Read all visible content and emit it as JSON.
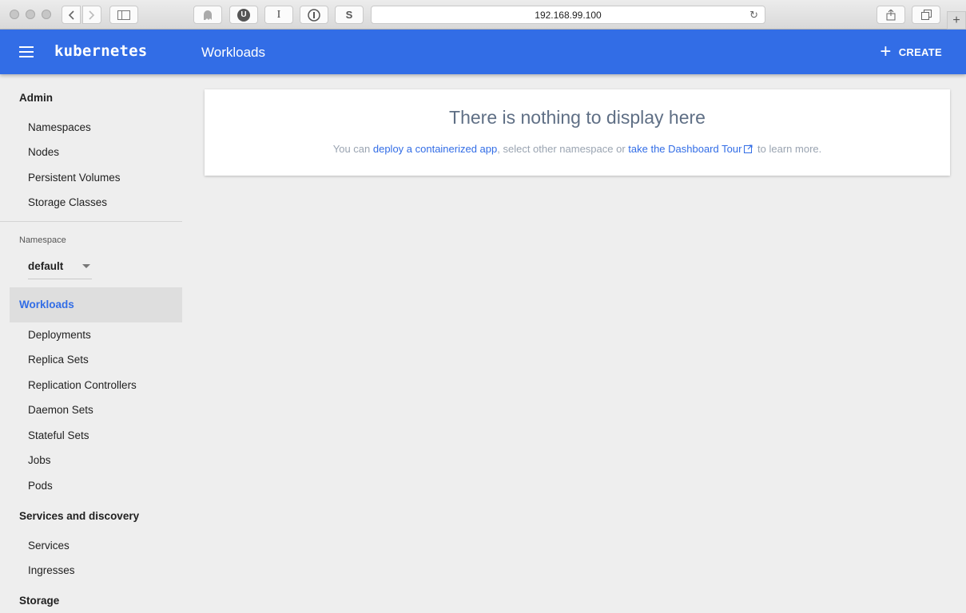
{
  "browser": {
    "url": "192.168.99.100",
    "toolbar_buttons": [
      "back-icon",
      "forward-icon",
      "sidebar-icon"
    ],
    "extension_labels": [
      "U",
      "I",
      "S"
    ]
  },
  "appbar": {
    "brand": "kubernetes",
    "title": "Workloads",
    "create_label": "CREATE",
    "color": "#326de6"
  },
  "sidebar": {
    "admin_heading": "Admin",
    "admin_items": [
      "Namespaces",
      "Nodes",
      "Persistent Volumes",
      "Storage Classes"
    ],
    "namespace_label": "Namespace",
    "namespace_value": "default",
    "workloads_heading": "Workloads",
    "workloads_items": [
      "Deployments",
      "Replica Sets",
      "Replication Controllers",
      "Daemon Sets",
      "Stateful Sets",
      "Jobs",
      "Pods"
    ],
    "services_heading": "Services and discovery",
    "services_items": [
      "Services",
      "Ingresses"
    ],
    "storage_heading": "Storage"
  },
  "empty_state": {
    "title": "There is nothing to display here",
    "prefix": "You can ",
    "link1": "deploy a containerized app",
    "middle": ", select other namespace or ",
    "link2": "take the Dashboard Tour",
    "suffix": " to learn more."
  }
}
